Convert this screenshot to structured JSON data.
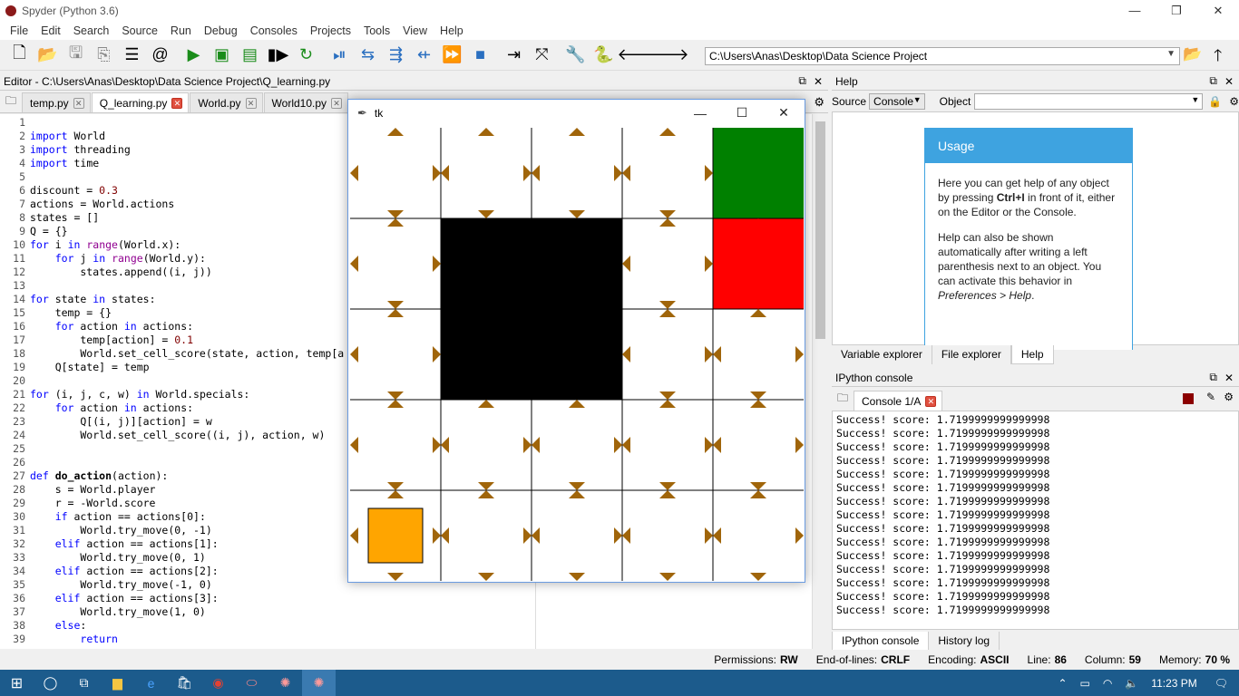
{
  "window": {
    "title": "Spyder (Python 3.6)",
    "minimize": "—",
    "maximize": "❐",
    "close": "✕"
  },
  "menu": [
    "File",
    "Edit",
    "Search",
    "Source",
    "Run",
    "Debug",
    "Consoles",
    "Projects",
    "Tools",
    "View",
    "Help"
  ],
  "toolbar": {
    "path": "C:\\Users\\Anas\\Desktop\\Data Science Project"
  },
  "editor": {
    "header": "Editor - C:\\Users\\Anas\\Desktop\\Data Science Project\\Q_learning.py",
    "tabs": [
      "temp.py",
      "Q_learning.py",
      "World.py",
      "World10.py"
    ],
    "active_tab": "Q_learning.py",
    "lines": [
      "",
      "import World",
      "import threading",
      "import time",
      "",
      "discount = 0.3",
      "actions = World.actions",
      "states = []",
      "Q = {}",
      "for i in range(World.x):",
      "    for j in range(World.y):",
      "        states.append((i, j))",
      "",
      "for state in states:",
      "    temp = {}",
      "    for action in actions:",
      "        temp[action] = 0.1",
      "        World.set_cell_score(state, action, temp[a",
      "    Q[state] = temp",
      "",
      "for (i, j, c, w) in World.specials:",
      "    for action in actions:",
      "        Q[(i, j)][action] = w",
      "        World.set_cell_score((i, j), action, w)",
      "",
      "",
      "def do_action(action):",
      "    s = World.player",
      "    r = -World.score",
      "    if action == actions[0]:",
      "        World.try_move(0, -1)",
      "    elif action == actions[1]:",
      "        World.try_move(0, 1)",
      "    elif action == actions[2]:",
      "        World.try_move(-1, 0)",
      "    elif action == actions[3]:",
      "        World.try_move(1, 0)",
      "    else:",
      "        return"
    ]
  },
  "tk": {
    "title": "tk",
    "minimize": "—",
    "maximize": "☐",
    "close": "✕"
  },
  "help": {
    "header": "Help",
    "source_label": "Source",
    "source_value": "Console",
    "object_label": "Object",
    "usage_title": "Usage",
    "p1a": "Here you can get help of any object by pressing ",
    "p1b": "Ctrl+I",
    "p1c": " in front of it, either on the Editor or the Console.",
    "p2": "Help can also be shown automatically after writing a left parenthesis next to an object. You can activate this behavior in ",
    "p2i": "Preferences > Help",
    "p2e": ".",
    "tabs": [
      "Variable explorer",
      "File explorer",
      "Help"
    ]
  },
  "console": {
    "header": "IPython console",
    "tab": "Console 1/A",
    "lines": [
      "Success! score:  1.7199999999999998",
      "Success! score:  1.7199999999999998",
      "Success! score:  1.7199999999999998",
      "Success! score:  1.7199999999999998",
      "Success! score:  1.7199999999999998",
      "Success! score:  1.7199999999999998",
      "Success! score:  1.7199999999999998",
      "Success! score:  1.7199999999999998",
      "Success! score:  1.7199999999999998",
      "Success! score:  1.7199999999999998",
      "Success! score:  1.7199999999999998",
      "Success! score:  1.7199999999999998",
      "Success! score:  1.7199999999999998",
      "Success! score:  1.7199999999999998",
      "Success! score:  1.7199999999999998"
    ],
    "bottom_tabs": [
      "IPython console",
      "History log"
    ]
  },
  "status": {
    "permissions_label": "Permissions:",
    "permissions": "RW",
    "eol_label": "End-of-lines:",
    "eol": "CRLF",
    "encoding_label": "Encoding:",
    "encoding": "ASCII",
    "line_label": "Line:",
    "line": "86",
    "column_label": "Column:",
    "column": "59",
    "memory_label": "Memory:",
    "memory": "70 %"
  },
  "taskbar": {
    "time": "11:23 PM"
  },
  "grid": {
    "cols": 5,
    "rows": 5,
    "walls": [
      [
        1,
        1
      ],
      [
        2,
        1
      ],
      [
        1,
        2
      ],
      [
        2,
        2
      ]
    ],
    "goal": [
      4,
      0
    ],
    "goal_color": "#008000",
    "trap": [
      4,
      1
    ],
    "trap_color": "#ff0000",
    "player": [
      0,
      4
    ],
    "player_color": "#ffa500",
    "arrow_color": "#a0650a"
  }
}
